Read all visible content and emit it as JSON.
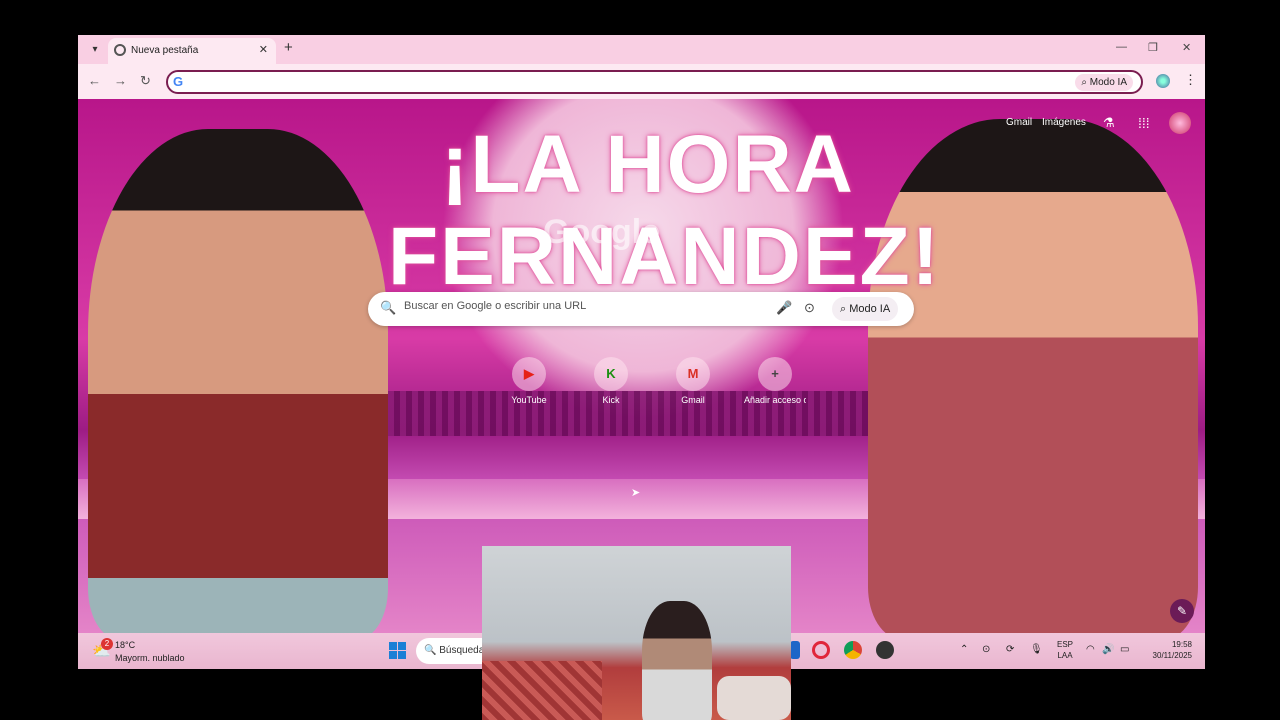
{
  "browser": {
    "tab_title": "Nueva pestaña",
    "omnibox_value": "",
    "omnibox_ai_button": "Modo IA"
  },
  "content": {
    "banner_line1": "¡LA HORA",
    "banner_line2": "FERNANDEZ!",
    "doodle_text": "Google",
    "links": {
      "gmail": "Gmail",
      "images": "Imágenes"
    },
    "search": {
      "placeholder": "Buscar en Google o escribir una URL",
      "ai_mode": "Modo IA"
    },
    "shortcuts": [
      {
        "label": "YouTube",
        "icon": "youtube-icon",
        "glyph": "▶",
        "color": "#e62117"
      },
      {
        "label": "Kick",
        "icon": "kick-icon",
        "glyph": "K",
        "color": "#53fc18"
      },
      {
        "label": "Gmail",
        "icon": "gmail-icon",
        "glyph": "M",
        "color": "#d93025"
      },
      {
        "label": "Añadir acceso directo",
        "icon": "plus-icon",
        "glyph": "+",
        "color": "#444444"
      }
    ]
  },
  "taskbar": {
    "weather_badge": "2",
    "temperature": "18°C",
    "condition": "Mayorm. nublado",
    "search_label": "Búsqueda",
    "lang_line1": "ESP",
    "lang_line2": "LAA",
    "time": "19:58",
    "date": "30/11/2025"
  }
}
